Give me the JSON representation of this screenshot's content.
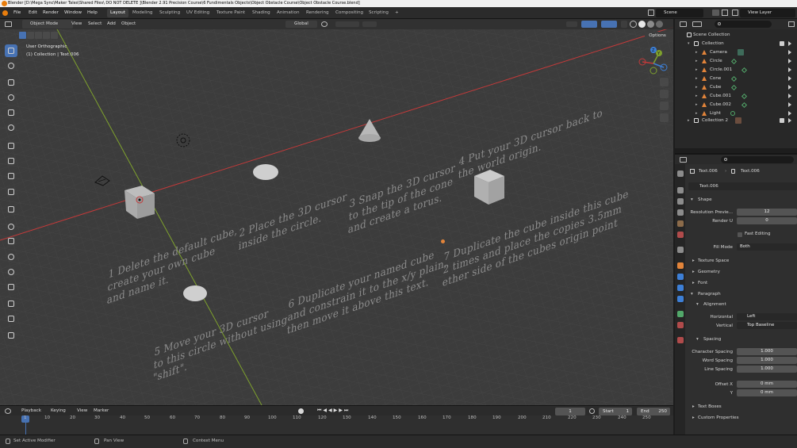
{
  "titlebar": {
    "title": "Blender [D:\\Mega Sync\\Maker Tales\\Shared Files\\ DO NOT DELETE ]\\Blender 2.91 Precision Course\\6 Fundimentals Objects\\Object Obstacle Course\\Object Obstacle Course.blend]"
  },
  "menu": [
    "File",
    "Edit",
    "Render",
    "Window",
    "Help"
  ],
  "workspaces": [
    "Layout",
    "Modeling",
    "Sculpting",
    "UV Editing",
    "Texture Paint",
    "Shading",
    "Animation",
    "Rendering",
    "Compositing",
    "Scripting"
  ],
  "active_workspace": "Layout",
  "add_workspace": "+",
  "scene": "Scene",
  "view_layer": "View Layer",
  "viewport_header": {
    "mode": "Object Mode",
    "view": "View",
    "select": "Select",
    "add": "Add",
    "object": "Object",
    "orientation": "Global",
    "options": "Options"
  },
  "viewport": {
    "view_name": "User Orthographic",
    "collection_info": "(1) Collection | Text.006",
    "instructions": [
      "1  Delete the default cube,",
      "create your own cube",
      "and name it.",
      "2  Place the 3D cursor",
      "inside the circle.",
      "3  Snap the 3D cursor",
      "to the tip of the cone",
      "and create a torus.",
      "4  Put your 3D cursor back to",
      "the world origin.",
      "5  Move your 3D cursor",
      "to this circle without using",
      "\"shift\".",
      "6  Duplicate your named cube",
      "and constrain it to the x/y plain,",
      "then move it above this text.",
      "7  Duplicate the cube inside this cube",
      "2 times and place the copies 3.5mm",
      "ether side of the cubes origin point"
    ],
    "gizmo_axes": [
      "X",
      "Y",
      "Z"
    ]
  },
  "timeline": {
    "menu": [
      "Playback",
      "Keying",
      "View",
      "Marker"
    ],
    "current_frame": "1",
    "start_label": "Start",
    "start": "1",
    "end_label": "End",
    "end": "250",
    "ticks": [
      "1",
      "10",
      "20",
      "30",
      "40",
      "50",
      "60",
      "70",
      "80",
      "90",
      "100",
      "110",
      "120",
      "130",
      "140",
      "150",
      "160",
      "170",
      "180",
      "190",
      "200",
      "210",
      "220",
      "230",
      "240",
      "250"
    ]
  },
  "statusbar": {
    "items": [
      "Set Active Modifier",
      "Pan View",
      "Context Menu"
    ]
  },
  "outliner": {
    "root": "Scene Collection",
    "rows": [
      {
        "name": "Collection",
        "kind": "collection"
      },
      {
        "name": "Camera",
        "kind": "object"
      },
      {
        "name": "Circle",
        "kind": "object"
      },
      {
        "name": "Circle.001",
        "kind": "object"
      },
      {
        "name": "Cone",
        "kind": "object"
      },
      {
        "name": "Cube",
        "kind": "object"
      },
      {
        "name": "Cube.001",
        "kind": "object"
      },
      {
        "name": "Cube.002",
        "kind": "object"
      },
      {
        "name": "Light",
        "kind": "object"
      },
      {
        "name": "Collection 2",
        "kind": "collection"
      }
    ]
  },
  "properties": {
    "breadcrumb_object": "Text.006",
    "breadcrumb_data": "Text.006",
    "datablock": "Text.006",
    "shape": {
      "title": "Shape",
      "resolution_preview_label": "Resolution Previe...",
      "resolution_preview": "12",
      "render_u_label": "Render U",
      "render_u": "0",
      "fast_editing": "Fast Editing",
      "fill_mode_label": "Fill Mode",
      "fill_mode": "Both"
    },
    "sections": [
      "Texture Space",
      "Geometry",
      "Font"
    ],
    "paragraph": {
      "title": "Paragraph",
      "alignment": "Alignment",
      "horizontal_label": "Horizontal",
      "horizontal": "Left",
      "vertical_label": "Vertical",
      "vertical": "Top Baseline",
      "spacing": "Spacing",
      "character_spacing_label": "Character Spacing",
      "character_spacing": "1.000",
      "word_spacing_label": "Word Spacing",
      "word_spacing": "1.000",
      "line_spacing_label": "Line Spacing",
      "line_spacing": "1.000",
      "offset_x_label": "Offset X",
      "offset_x": "0 mm",
      "offset_y_label": "Y",
      "offset_y": "0 mm"
    },
    "text_boxes": "Text Boxes",
    "custom_properties": "Custom Properties"
  },
  "colors": {
    "accent": "#4772b3",
    "x_axis": "#c23a3a",
    "y_axis": "#7ea12d",
    "object_orange": "#e2843a",
    "viewport_bg": "#3c3c3c"
  }
}
